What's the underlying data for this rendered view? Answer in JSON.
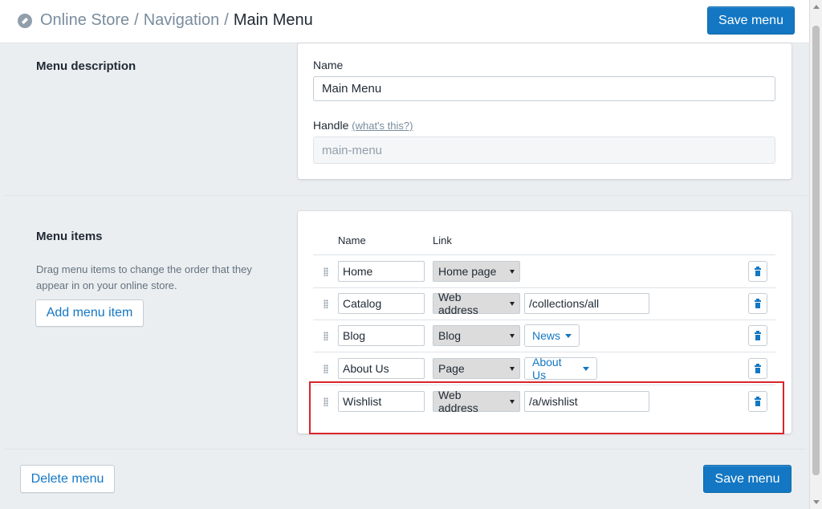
{
  "header": {
    "breadcrumb": [
      "Online Store",
      "Navigation"
    ],
    "separator": "/",
    "current": "Main Menu",
    "save_label": "Save menu"
  },
  "description_section": {
    "title": "Menu description",
    "name_label": "Name",
    "name_value": "Main Menu",
    "handle_label": "Handle",
    "handle_help_link": "(what's this?)",
    "handle_value": "main-menu"
  },
  "items_section": {
    "title": "Menu items",
    "helper_text": "Drag menu items to change the order that they appear in on your online store.",
    "add_label": "Add menu item",
    "columns": {
      "name": "Name",
      "link": "Link"
    },
    "rows": [
      {
        "name": "Home",
        "link_type": "Home page",
        "link_value": "",
        "link_dropdown": ""
      },
      {
        "name": "Catalog",
        "link_type": "Web address",
        "link_value": "/collections/all",
        "link_dropdown": ""
      },
      {
        "name": "Blog",
        "link_type": "Blog",
        "link_value": "",
        "link_dropdown": "News"
      },
      {
        "name": "About Us",
        "link_type": "Page",
        "link_value": "",
        "link_dropdown": "About Us"
      },
      {
        "name": "Wishlist",
        "link_type": "Web address",
        "link_value": "/a/wishlist",
        "link_dropdown": ""
      }
    ]
  },
  "footer": {
    "delete_label": "Delete menu",
    "save_label": "Save menu"
  },
  "colors": {
    "primary": "#1377c3",
    "background": "#ebeef0",
    "highlight_border": "#d9252a"
  },
  "icons": [
    "compass-icon",
    "drag-handle-icon",
    "trash-icon",
    "caret-down-icon"
  ]
}
